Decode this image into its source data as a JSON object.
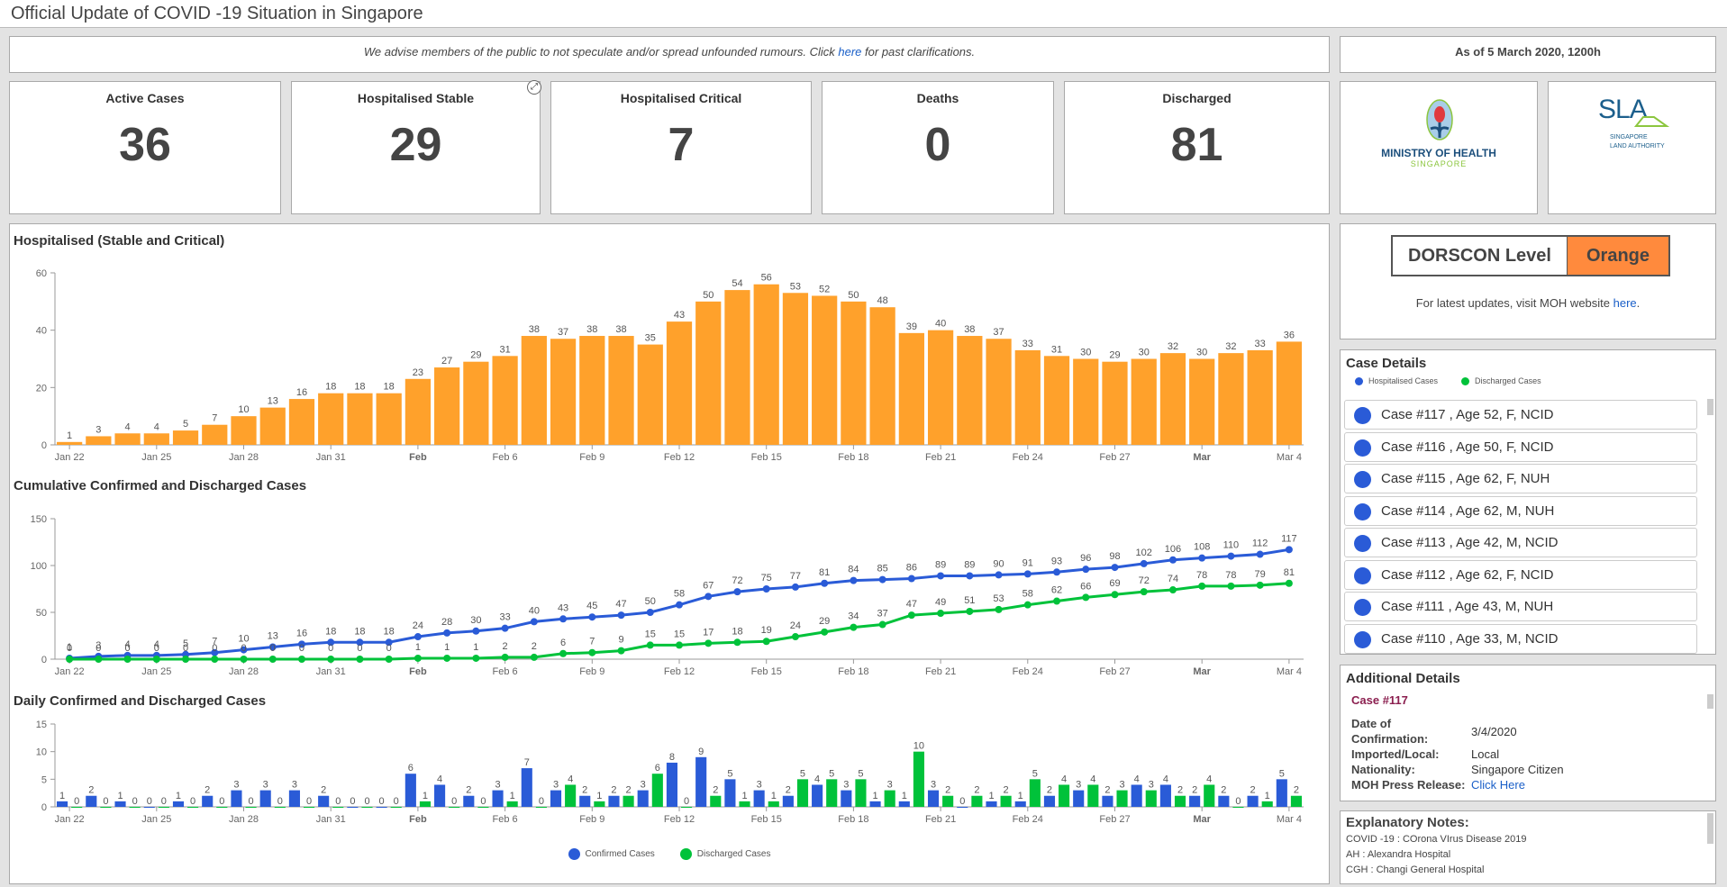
{
  "title": "Official Update of COVID -19 Situation in Singapore",
  "notice": {
    "before": "We advise members of the public to not speculate and/or spread unfounded rumours.  Click ",
    "link": "here",
    "after": " for past clarifications."
  },
  "as_of": "As of 5 March 2020, 1200h",
  "stats": [
    {
      "label": "Active Cases",
      "value": "36"
    },
    {
      "label": "Hospitalised Stable",
      "value": "29"
    },
    {
      "label": "Hospitalised Critical",
      "value": "7"
    },
    {
      "label": "Deaths",
      "value": "0"
    },
    {
      "label": "Discharged",
      "value": "81"
    }
  ],
  "logos": {
    "moh": {
      "line1": "MINISTRY OF HEALTH",
      "line2": "SINGAPORE"
    },
    "sla": {
      "mark": "SLA",
      "line1": "SINGAPORE",
      "line2": "LAND AUTHORITY"
    }
  },
  "dorscon": {
    "label": "DORSCON Level",
    "level": "Orange",
    "level_color": "#ff8a3d",
    "msg_before": "For latest updates, visit MOH website ",
    "msg_link": "here",
    "msg_after": "."
  },
  "case_details": {
    "title": "Case Details",
    "legend": [
      {
        "label": "Hospitalised Cases",
        "color": "#2a5bd7"
      },
      {
        "label": "Discharged Cases",
        "color": "#00c23a"
      }
    ],
    "items": [
      "Case #117 , Age 52, F, NCID",
      "Case #116 , Age 50, F, NCID",
      "Case #115 , Age 62, F, NUH",
      "Case #114 , Age 62, M, NUH",
      "Case #113 , Age 42, M, NCID",
      "Case #112 , Age 62, F, NCID",
      "Case #111 , Age 43, M, NUH",
      "Case #110 , Age 33, M, NCID"
    ]
  },
  "additional": {
    "title": "Additional Details",
    "case": "Case #117",
    "rows": [
      {
        "k": "Date of Confirmation:",
        "v": "3/4/2020"
      },
      {
        "k": "Imported/Local:",
        "v": "Local"
      },
      {
        "k": "Nationality:",
        "v": "Singapore Citizen"
      },
      {
        "k": "MOH Press Release:",
        "v": "Click Here"
      }
    ]
  },
  "explanatory": {
    "title": "Explanatory Notes:",
    "notes": [
      "COVID -19 : COrona VIrus Disease 2019",
      "AH : Alexandra Hospital",
      "CGH : Changi General Hospital"
    ]
  },
  "chart_data": [
    {
      "type": "bar",
      "title": "Hospitalised (Stable and Critical)",
      "color": "#ffa12b",
      "ylim": [
        0,
        60
      ],
      "yticks": [
        0,
        20,
        40,
        60
      ],
      "xticks": [
        "Jan 22",
        "Jan 25",
        "Jan 28",
        "Jan 31",
        "Feb",
        "Feb 6",
        "Feb 9",
        "Feb 12",
        "Feb 15",
        "Feb 18",
        "Feb 21",
        "Feb 24",
        "Feb 27",
        "Mar",
        "Mar 4"
      ],
      "values": [
        1,
        3,
        4,
        4,
        5,
        7,
        10,
        13,
        16,
        18,
        18,
        18,
        23,
        27,
        29,
        31,
        38,
        37,
        38,
        38,
        35,
        43,
        50,
        54,
        56,
        53,
        52,
        50,
        48,
        39,
        40,
        38,
        37,
        33,
        31,
        30,
        29,
        30,
        32,
        30,
        32,
        33,
        36
      ]
    },
    {
      "type": "line",
      "title": "Cumulative Confirmed and Discharged Cases",
      "ylim": [
        0,
        150
      ],
      "yticks": [
        0,
        50,
        100,
        150
      ],
      "xticks": [
        "Jan 22",
        "Jan 25",
        "Jan 28",
        "Jan 31",
        "Feb",
        "Feb 6",
        "Feb 9",
        "Feb 12",
        "Feb 15",
        "Feb 18",
        "Feb 21",
        "Feb 24",
        "Feb 27",
        "Mar",
        "Mar 4"
      ],
      "series": [
        {
          "color": "#2a5bd7",
          "values": [
            1,
            3,
            4,
            4,
            5,
            7,
            10,
            13,
            16,
            18,
            18,
            18,
            24,
            28,
            30,
            33,
            40,
            43,
            45,
            47,
            50,
            58,
            67,
            72,
            75,
            77,
            81,
            84,
            85,
            86,
            89,
            89,
            90,
            91,
            93,
            96,
            98,
            102,
            106,
            108,
            110,
            112,
            117
          ]
        },
        {
          "color": "#00c23a",
          "values": [
            0,
            0,
            0,
            0,
            0,
            0,
            0,
            0,
            0,
            0,
            0,
            0,
            1,
            1,
            1,
            2,
            2,
            6,
            7,
            9,
            15,
            15,
            17,
            18,
            19,
            24,
            29,
            34,
            37,
            47,
            49,
            51,
            53,
            58,
            62,
            66,
            69,
            72,
            74,
            78,
            78,
            79,
            81
          ]
        }
      ]
    },
    {
      "type": "bar",
      "title": "Daily Confirmed and Discharged Cases",
      "ylim": [
        0,
        15
      ],
      "yticks": [
        0,
        5,
        10,
        15
      ],
      "xticks": [
        "Jan 22",
        "Jan 25",
        "Jan 28",
        "Jan 31",
        "Feb",
        "Feb 6",
        "Feb 9",
        "Feb 12",
        "Feb 15",
        "Feb 18",
        "Feb 21",
        "Feb 24",
        "Feb 27",
        "Mar",
        "Mar 4"
      ],
      "legend_position": "bottom",
      "series": [
        {
          "name": "Confirmed Cases",
          "color": "#2a5bd7",
          "values": [
            1,
            2,
            1,
            0,
            1,
            2,
            3,
            3,
            3,
            2,
            0,
            0,
            6,
            4,
            2,
            3,
            7,
            3,
            2,
            2,
            3,
            8,
            9,
            5,
            3,
            2,
            4,
            3,
            1,
            1,
            3,
            0,
            1,
            1,
            2,
            3,
            2,
            4,
            4,
            2,
            2,
            2,
            5
          ]
        },
        {
          "name": "Discharged Cases",
          "color": "#00c23a",
          "values": [
            0,
            0,
            0,
            0,
            0,
            0,
            0,
            0,
            0,
            0,
            0,
            0,
            1,
            0,
            0,
            1,
            0,
            4,
            1,
            2,
            6,
            0,
            2,
            1,
            1,
            5,
            5,
            5,
            3,
            10,
            2,
            2,
            2,
            5,
            4,
            4,
            3,
            3,
            2,
            4,
            0,
            1,
            2
          ]
        }
      ]
    }
  ]
}
